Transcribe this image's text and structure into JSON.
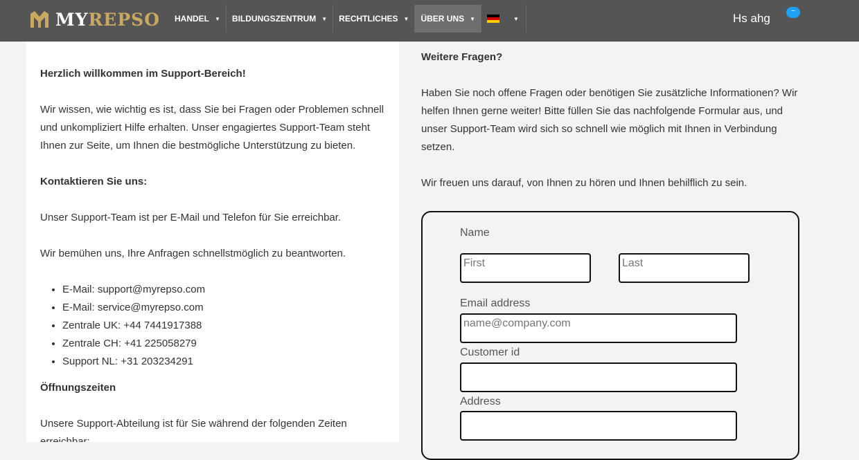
{
  "header": {
    "logo_my": "MY",
    "logo_repso": "REPSO",
    "nav": [
      {
        "label": "HANDEL"
      },
      {
        "label": "BILDUNGSZENTRUM"
      },
      {
        "label": "RECHTLICHES"
      },
      {
        "label": "ÜBER UNS"
      }
    ],
    "user_name": "Hs ahg",
    "notification_badge": "~",
    "colors": {
      "bar": "#555555",
      "brand_gold": "#c9a961",
      "badge": "#1da1f2"
    }
  },
  "left": {
    "welcome_heading": "Herzlich willkommen im Support-Bereich!",
    "intro": "Wir wissen, wie wichtig es ist, dass Sie bei Fragen oder Problemen schnell und unkompliziert Hilfe erhalten. Unser engagiertes Support-Team steht Ihnen zur Seite, um Ihnen die bestmögliche Unterstützung zu bieten.",
    "contact_heading": "Kontaktieren Sie uns:",
    "contact_text": "Unser Support-Team ist per E-Mail und Telefon für Sie erreichbar.",
    "response_text": "Wir bemühen uns, Ihre Anfragen schnellstmöglich zu beantworten.",
    "contacts": [
      "E-Mail: support@myrepso.com",
      "E-Mail: service@myrepso.com",
      "Zentrale UK: +44 7441917388",
      "Zentrale CH: +41 225058279",
      "Support NL: +31 203234291"
    ],
    "hours_heading": "Öffnungszeiten",
    "hours_text": "Unsere Support-Abteilung ist für Sie während der folgenden Zeiten erreichbar:"
  },
  "right": {
    "heading": "Weitere Fragen?",
    "paragraph1": "Haben Sie noch offene Fragen oder benötigen Sie zusätzliche Informationen? Wir helfen Ihnen gerne weiter! Bitte füllen Sie das nachfolgende Formular aus, und unser Support-Team wird sich so schnell wie möglich mit Ihnen in Verbindung setzen.",
    "paragraph2": "Wir freuen uns darauf, von Ihnen zu hören und Ihnen behilflich zu sein."
  },
  "form": {
    "name_label": "Name",
    "first_placeholder": "First",
    "last_placeholder": "Last",
    "email_label": "Email address",
    "email_placeholder": "name@company.com",
    "customer_id_label": "Customer id",
    "address_label": "Address"
  }
}
